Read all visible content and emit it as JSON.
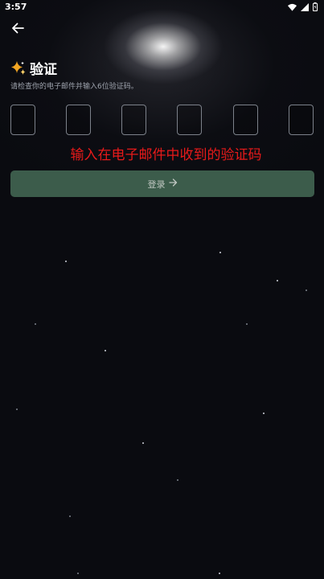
{
  "status_bar": {
    "time": "3:57"
  },
  "header": {
    "back_icon": "arrow-left-icon"
  },
  "verify": {
    "title": "验证",
    "title_icon": "sparkle-icon",
    "subtitle": "请检查你的电子邮件并输入6位验证码。",
    "code_digits": [
      "",
      "",
      "",
      "",
      "",
      ""
    ]
  },
  "overlay": {
    "instruction": "输入在电子邮件中收到的验证码"
  },
  "login_button": {
    "label": "登录",
    "icon": "arrow-right-icon"
  },
  "colors": {
    "background": "#0a0b10",
    "button": "#3c5c4b",
    "overlay_text": "#e81a1a",
    "sparkle": "#f2a623"
  }
}
